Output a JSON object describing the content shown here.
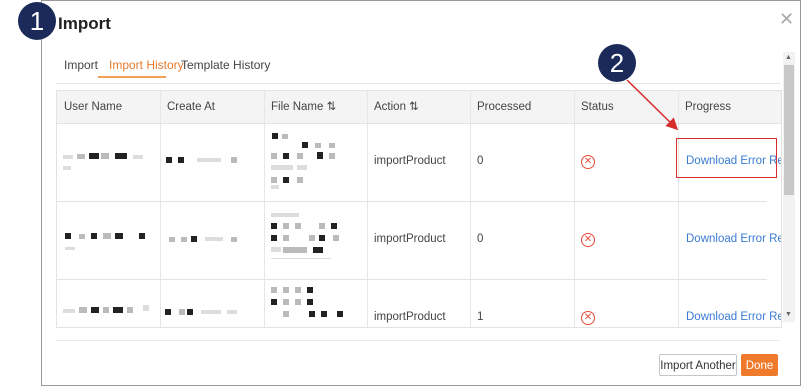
{
  "markers": {
    "step1": "1",
    "step2": "2"
  },
  "dialog": {
    "title": "Import",
    "close_icon": "close-icon",
    "tabs": [
      {
        "label": "Import",
        "active": false
      },
      {
        "label": "Import History",
        "active": true
      },
      {
        "label": "Template History",
        "active": false
      }
    ]
  },
  "table": {
    "columns": [
      "User Name",
      "Create At",
      "File Name ⇅",
      "Action ⇅",
      "Processed",
      "Status",
      "Progress"
    ],
    "rows": [
      {
        "action": "importProduct",
        "processed": "0",
        "status_icon": "error-circle-icon",
        "progress": "Download Error Report"
      },
      {
        "action": "importProduct",
        "processed": "0",
        "status_icon": "error-circle-icon",
        "progress": "Download Error Report"
      },
      {
        "action": "importProduct",
        "processed": "1",
        "status_icon": "error-circle-icon",
        "progress": "Download Error Report"
      }
    ]
  },
  "footer": {
    "import_another_label": "Import Another",
    "done_label": "Done"
  },
  "colors": {
    "accent": "#f07a2b",
    "link": "#3a7bd5",
    "error": "#e74c3c",
    "annotation_badge": "#1b2a59",
    "annotation_highlight": "#d62d2d"
  }
}
